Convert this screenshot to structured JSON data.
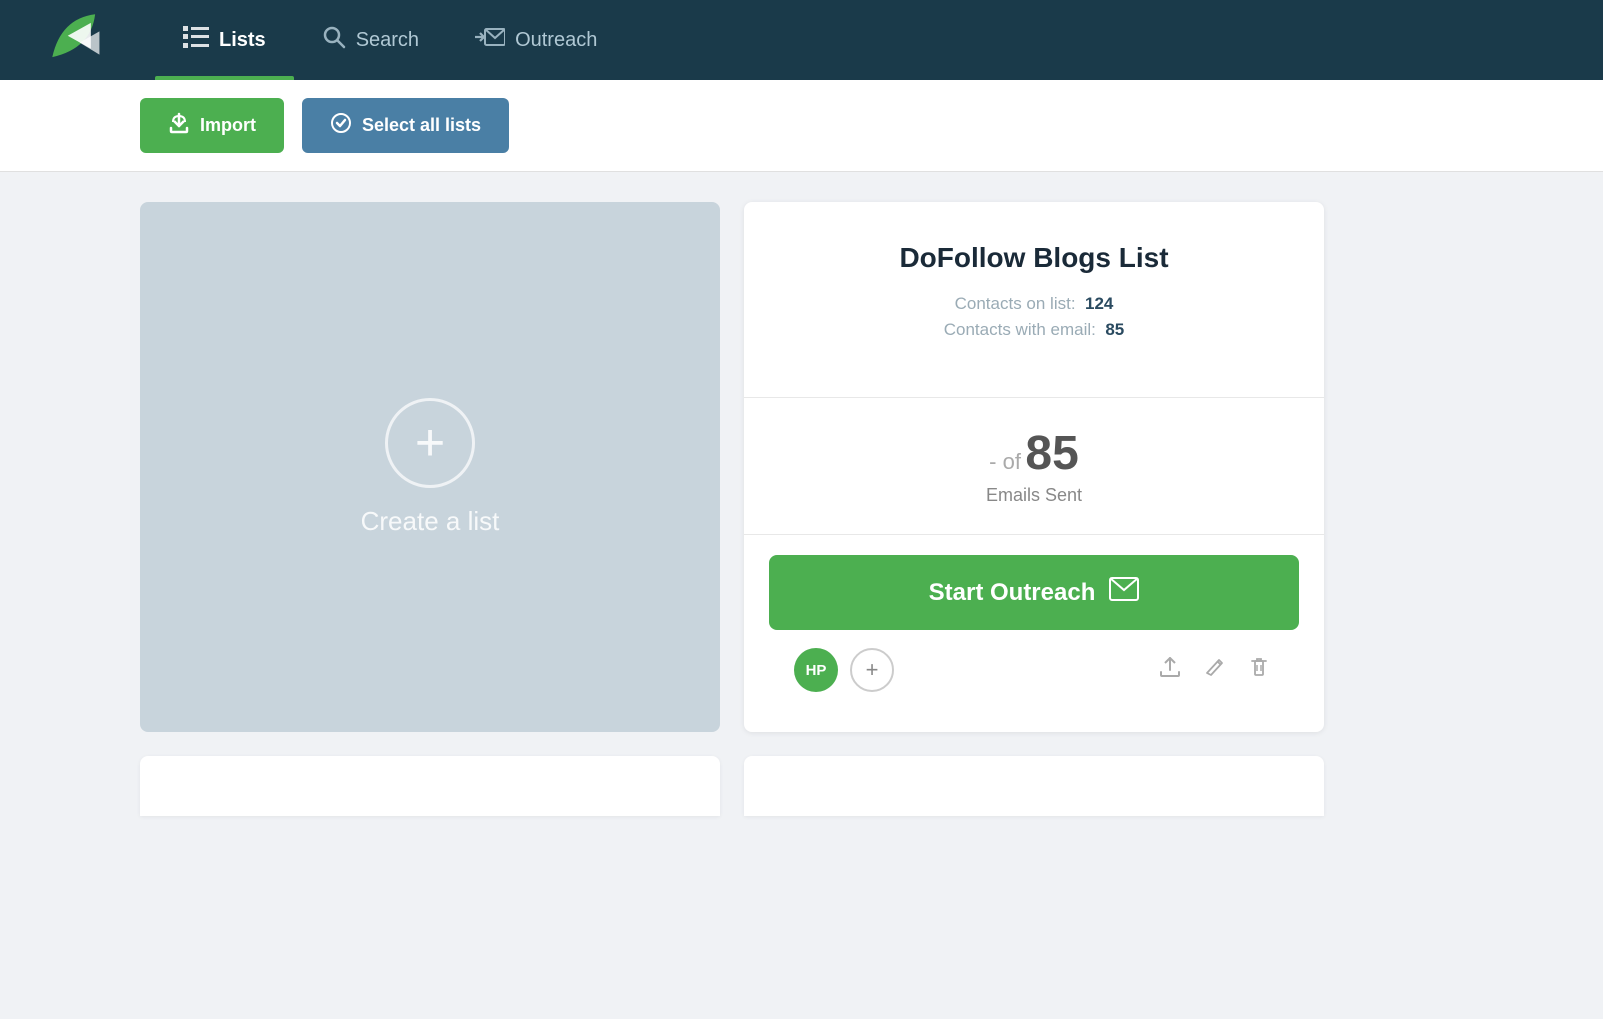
{
  "header": {
    "nav_items": [
      {
        "id": "lists",
        "label": "Lists",
        "active": true,
        "icon": "☰"
      },
      {
        "id": "search",
        "label": "Search",
        "active": false,
        "icon": "🔍"
      },
      {
        "id": "outreach",
        "label": "Outreach",
        "active": false,
        "icon": "✉"
      }
    ]
  },
  "toolbar": {
    "import_label": "Import",
    "select_all_label": "Select all lists"
  },
  "create_card": {
    "label": "Create a list"
  },
  "detail_card": {
    "title": "DoFollow Blogs List",
    "contacts_on_list_label": "Contacts on list:",
    "contacts_on_list_value": "124",
    "contacts_with_email_label": "Contacts with email:",
    "contacts_with_email_value": "85",
    "emails_sent_prefix": "- of",
    "emails_sent_count": "85",
    "emails_sent_label": "Emails Sent",
    "start_outreach_label": "Start Outreach",
    "avatar_initials": "HP"
  }
}
